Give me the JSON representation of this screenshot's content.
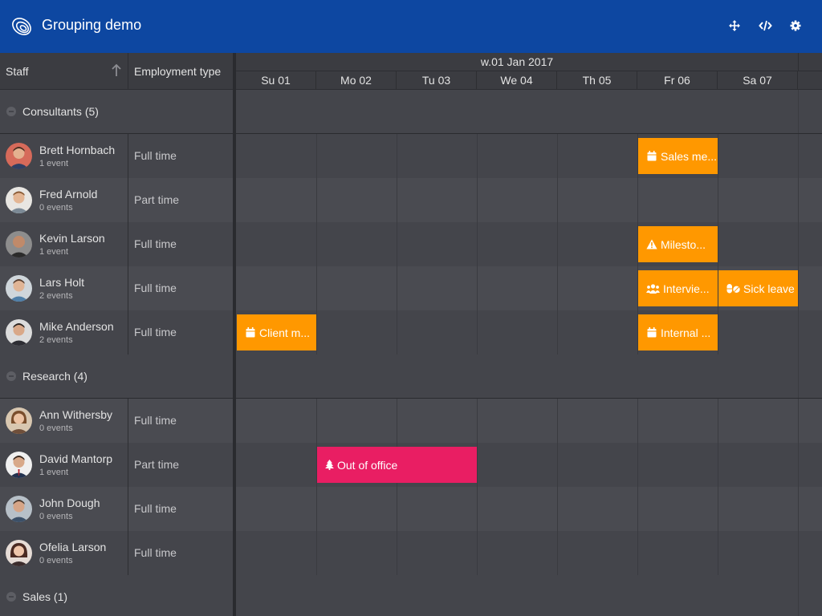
{
  "header": {
    "title": "Grouping demo",
    "buttons": [
      "move-icon",
      "code-icon",
      "gear-icon"
    ]
  },
  "columns": {
    "staff": "Staff",
    "employment": "Employment type"
  },
  "timeline": {
    "week": "w.01 Jan 2017",
    "days": [
      "Su 01",
      "Mo 02",
      "Tu 03",
      "We 04",
      "Th 05",
      "Fr 06",
      "Sa 07"
    ]
  },
  "groups": [
    {
      "label": "Consultants (5)",
      "people": [
        {
          "name": "Brett Hornbach",
          "events": "1 event",
          "type": "Full time"
        },
        {
          "name": "Fred Arnold",
          "events": "0 events",
          "type": "Part time"
        },
        {
          "name": "Kevin Larson",
          "events": "1 event",
          "type": "Full time"
        },
        {
          "name": "Lars Holt",
          "events": "2 events",
          "type": "Full time"
        },
        {
          "name": "Mike Anderson",
          "events": "2 events",
          "type": "Full time"
        }
      ]
    },
    {
      "label": "Research (4)",
      "people": [
        {
          "name": "Ann Withersby",
          "events": "0 events",
          "type": "Full time"
        },
        {
          "name": "David Mantorp",
          "events": "1 event",
          "type": "Part time"
        },
        {
          "name": "John Dough",
          "events": "0 events",
          "type": "Full time"
        },
        {
          "name": "Ofelia Larson",
          "events": "0 events",
          "type": "Full time"
        }
      ]
    },
    {
      "label": "Sales (1)",
      "people": []
    }
  ],
  "events": [
    {
      "label": "Sales me...",
      "icon": "calendar-icon",
      "color": "#ff9800"
    },
    {
      "label": "Milesto...",
      "icon": "warning-icon",
      "color": "#ff9800"
    },
    {
      "label": "Intervie...",
      "icon": "users-icon",
      "color": "#ff9800"
    },
    {
      "label": "Sick leave",
      "icon": "pills-icon",
      "color": "#ff9800"
    },
    {
      "label": "Client m...",
      "icon": "calendar-icon",
      "color": "#ff9800"
    },
    {
      "label": "Internal ...",
      "icon": "calendar-icon",
      "color": "#ff9800"
    },
    {
      "label": "Out of office",
      "icon": "tree-icon",
      "color": "#e91e63"
    }
  ],
  "colors": {
    "header_bg": "#0d47a1",
    "event_orange": "#ff9800",
    "event_pink": "#e91e63"
  }
}
